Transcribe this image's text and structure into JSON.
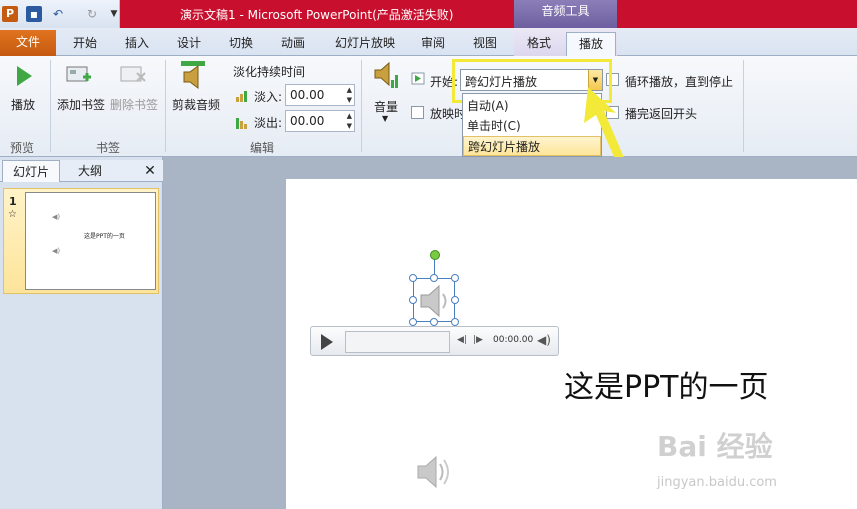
{
  "app": {
    "title": "演示文稿1 - Microsoft PowerPoint(产品激活失败)",
    "context_tab_group": "音频工具"
  },
  "qat": {
    "logo": "P",
    "icons": [
      "save-icon",
      "undo-icon",
      "redo-icon"
    ]
  },
  "tabs": [
    "文件",
    "开始",
    "插入",
    "设计",
    "切换",
    "动画",
    "幻灯片放映",
    "审阅",
    "视图",
    "格式",
    "播放"
  ],
  "ribbon": {
    "preview": {
      "play_label": "播放",
      "group": "预览"
    },
    "bookmarks": {
      "add_label": "添加书签",
      "delete_label": "删除书签",
      "group": "书签"
    },
    "editing": {
      "trim_label": "剪裁音频",
      "fade_title": "淡化持续时间",
      "fade_in_label": "淡入:",
      "fade_in_value": "00.00",
      "fade_out_label": "淡出:",
      "fade_out_value": "00.00",
      "group": "编辑"
    },
    "audio_options": {
      "volume_label": "音量",
      "start_label": "开始:",
      "start_value": "跨幻灯片播放",
      "hide_during_show_label": "放映时",
      "loop_label": "循环播放，直到停止",
      "rewind_label": "播完返回开头"
    },
    "start_menu": [
      "自动(A)",
      "单击时(C)",
      "跨幻灯片播放"
    ]
  },
  "pane": {
    "tabs": [
      "幻灯片",
      "大纲"
    ],
    "slide_number": "1",
    "thumb_text": "这是PPT的一页"
  },
  "slide": {
    "text": "这是PPT的一页",
    "player_time": "00:00.00"
  },
  "watermark": {
    "line1": "Bai 经验",
    "line2": "jingyan.baidu.com"
  },
  "colors": {
    "title_bar": "#c8102e",
    "file_tab": "#c55a11",
    "highlight": "#f3e939",
    "context_group": "#7d6fb0"
  }
}
